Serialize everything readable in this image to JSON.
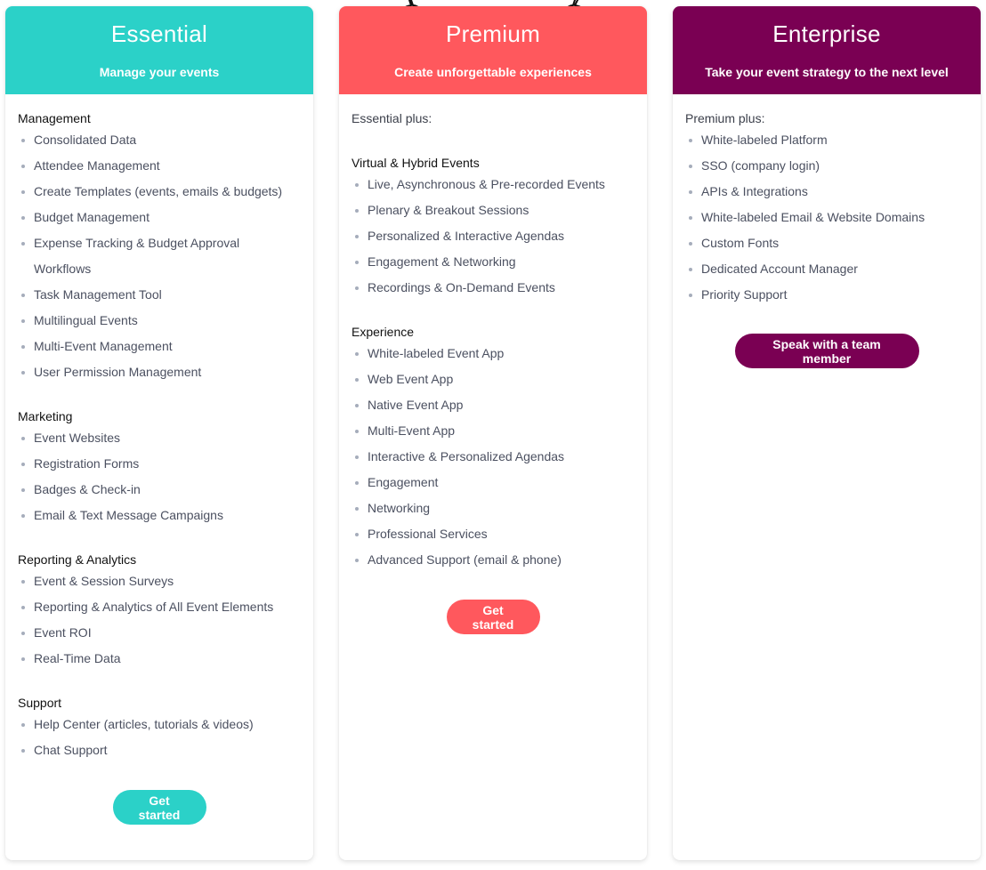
{
  "colors": {
    "essential": "#2bd1c8",
    "premium": "#ff585d",
    "enterprise": "#7a0053",
    "feature_text": "#4b5060",
    "section_title": "#111111",
    "bullet": "#a6adbb"
  },
  "plans": {
    "essential": {
      "title": "Essential",
      "subtitle": "Manage your events",
      "sections": [
        {
          "title": "Management",
          "items": [
            "Consolidated Data",
            "Attendee Management",
            "Create Templates (events, emails & budgets)",
            "Budget Management",
            "Expense Tracking & Budget Approval Workflows",
            "Task Management Tool",
            "Multilingual Events",
            "Multi-Event Management",
            "User Permission Management"
          ]
        },
        {
          "title": "Marketing",
          "items": [
            "Event Websites",
            "Registration Forms",
            "Badges & Check-in",
            "Email & Text Message Campaigns"
          ]
        },
        {
          "title": "Reporting & Analytics",
          "items": [
            "Event & Session Surveys",
            "Reporting & Analytics of All Event Elements",
            "Event ROI",
            "Real-Time Data"
          ]
        },
        {
          "title": "Support",
          "items": [
            "Help Center (articles, tutorials & videos)",
            "Chat Support"
          ]
        }
      ],
      "cta_label": "Get started"
    },
    "premium": {
      "title": "Premium",
      "subtitle": "Create unforgettable experiences",
      "intro": "Essential plus:",
      "sections": [
        {
          "title": "Virtual & Hybrid Events",
          "items": [
            "Live, Asynchronous & Pre-recorded Events",
            "Plenary & Breakout Sessions",
            "Personalized & Interactive Agendas",
            "Engagement & Networking",
            "Recordings & On-Demand Events"
          ]
        },
        {
          "title": "Experience",
          "items": [
            "White-labeled Event App",
            "Web Event App",
            "Native Event App",
            "Multi-Event App",
            "Interactive & Personalized Agendas",
            "Engagement",
            "Networking",
            "Professional Services",
            "Advanced Support (email & phone)"
          ]
        }
      ],
      "cta_label": "Get started"
    },
    "enterprise": {
      "title": "Enterprise",
      "subtitle": "Take your event strategy to the next level",
      "intro": "Premium plus:",
      "items": [
        "White-labeled Platform",
        "SSO (company login)",
        "APIs & Integrations",
        "White-labeled Email & Website Domains",
        "Custom Fonts",
        "Dedicated Account Manager",
        "Priority Support"
      ],
      "cta_label": "Speak with a team member"
    }
  }
}
